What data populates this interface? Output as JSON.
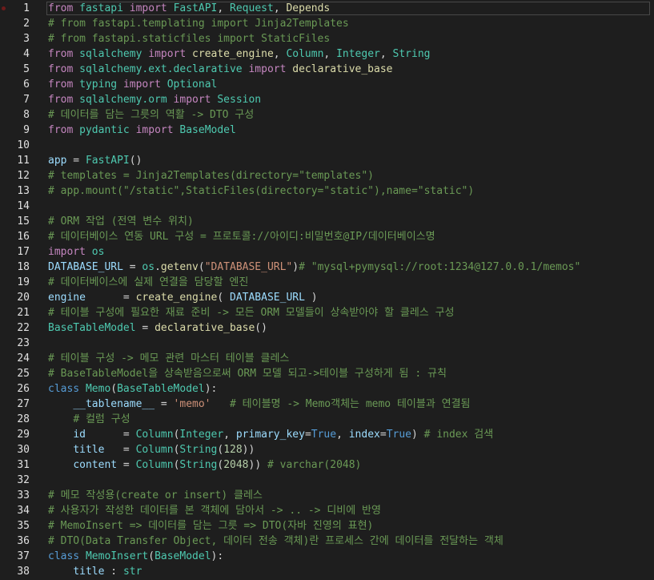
{
  "editor": {
    "breakpoint_line": 1,
    "active_line": 1,
    "lines": [
      {
        "n": "1",
        "tokens": [
          {
            "t": "from",
            "c": "from"
          },
          {
            "t": " "
          },
          {
            "t": "fastapi",
            "c": "module"
          },
          {
            "t": " "
          },
          {
            "t": "import",
            "c": "import"
          },
          {
            "t": " "
          },
          {
            "t": "FastAPI",
            "c": "class"
          },
          {
            "t": ", "
          },
          {
            "t": "Request",
            "c": "class"
          },
          {
            "t": ", "
          },
          {
            "t": "Depends",
            "c": "func"
          }
        ]
      },
      {
        "n": "2",
        "tokens": [
          {
            "t": "# from fastapi.templating import Jinja2Templates",
            "c": "comment"
          }
        ]
      },
      {
        "n": "3",
        "tokens": [
          {
            "t": "# from fastapi.staticfiles import StaticFiles",
            "c": "comment"
          }
        ]
      },
      {
        "n": "4",
        "tokens": [
          {
            "t": "from",
            "c": "from"
          },
          {
            "t": " "
          },
          {
            "t": "sqlalchemy",
            "c": "module"
          },
          {
            "t": " "
          },
          {
            "t": "import",
            "c": "import"
          },
          {
            "t": " "
          },
          {
            "t": "create_engine",
            "c": "func"
          },
          {
            "t": ", "
          },
          {
            "t": "Column",
            "c": "class"
          },
          {
            "t": ", "
          },
          {
            "t": "Integer",
            "c": "class"
          },
          {
            "t": ", "
          },
          {
            "t": "String",
            "c": "class"
          }
        ]
      },
      {
        "n": "5",
        "tokens": [
          {
            "t": "from",
            "c": "from"
          },
          {
            "t": " "
          },
          {
            "t": "sqlalchemy.ext.declarative",
            "c": "module"
          },
          {
            "t": " "
          },
          {
            "t": "import",
            "c": "import"
          },
          {
            "t": " "
          },
          {
            "t": "declarative_base",
            "c": "func"
          }
        ]
      },
      {
        "n": "6",
        "tokens": [
          {
            "t": "from",
            "c": "from"
          },
          {
            "t": " "
          },
          {
            "t": "typing",
            "c": "module"
          },
          {
            "t": " "
          },
          {
            "t": "import",
            "c": "import"
          },
          {
            "t": " "
          },
          {
            "t": "Optional",
            "c": "class"
          }
        ]
      },
      {
        "n": "7",
        "tokens": [
          {
            "t": "from",
            "c": "from"
          },
          {
            "t": " "
          },
          {
            "t": "sqlalchemy.orm",
            "c": "module"
          },
          {
            "t": " "
          },
          {
            "t": "import",
            "c": "import"
          },
          {
            "t": " "
          },
          {
            "t": "Session",
            "c": "class"
          }
        ]
      },
      {
        "n": "8",
        "tokens": [
          {
            "t": "# 데이터를 담는 그릇의 역활 -> DTO 구성",
            "c": "comment"
          }
        ]
      },
      {
        "n": "9",
        "tokens": [
          {
            "t": "from",
            "c": "from"
          },
          {
            "t": " "
          },
          {
            "t": "pydantic",
            "c": "module"
          },
          {
            "t": " "
          },
          {
            "t": "import",
            "c": "import"
          },
          {
            "t": " "
          },
          {
            "t": "BaseModel",
            "c": "class"
          }
        ]
      },
      {
        "n": "10",
        "tokens": []
      },
      {
        "n": "11",
        "tokens": [
          {
            "t": "app",
            "c": "var"
          },
          {
            "t": " = "
          },
          {
            "t": "FastAPI",
            "c": "class"
          },
          {
            "t": "()"
          }
        ]
      },
      {
        "n": "12",
        "tokens": [
          {
            "t": "# templates = Jinja2Templates(directory=\"templates\")",
            "c": "comment"
          }
        ]
      },
      {
        "n": "13",
        "tokens": [
          {
            "t": "# app.mount(\"/static\",StaticFiles(directory=\"static\"),name=\"static\")",
            "c": "comment"
          }
        ]
      },
      {
        "n": "14",
        "tokens": []
      },
      {
        "n": "15",
        "tokens": [
          {
            "t": "# ORM 작업 (전역 변수 위치)",
            "c": "comment"
          }
        ]
      },
      {
        "n": "16",
        "tokens": [
          {
            "t": "# 데이터베이스 연동 URL 구성 = 프로토콜://아이디:비밀번호@IP/데이터베이스명",
            "c": "comment"
          }
        ]
      },
      {
        "n": "17",
        "tokens": [
          {
            "t": "import",
            "c": "import"
          },
          {
            "t": " "
          },
          {
            "t": "os",
            "c": "module"
          }
        ]
      },
      {
        "n": "18",
        "tokens": [
          {
            "t": "DATABASE_URL",
            "c": "var"
          },
          {
            "t": " = "
          },
          {
            "t": "os",
            "c": "module"
          },
          {
            "t": "."
          },
          {
            "t": "getenv",
            "c": "func"
          },
          {
            "t": "("
          },
          {
            "t": "\"DATABASE_URL\"",
            "c": "str"
          },
          {
            "t": ")"
          },
          {
            "t": "# \"mysql+pymysql://root:1234@127.0.0.1/memos\"",
            "c": "comment"
          }
        ]
      },
      {
        "n": "19",
        "tokens": [
          {
            "t": "# 데이터베이스에 실제 연결을 담당할 엔진",
            "c": "comment"
          }
        ]
      },
      {
        "n": "20",
        "tokens": [
          {
            "t": "engine",
            "c": "var"
          },
          {
            "t": "      = "
          },
          {
            "t": "create_engine",
            "c": "func"
          },
          {
            "t": "( "
          },
          {
            "t": "DATABASE_URL",
            "c": "var"
          },
          {
            "t": " )"
          }
        ]
      },
      {
        "n": "21",
        "tokens": [
          {
            "t": "# 테이블 구성에 필요한 재료 준비 -> 모든 ORM 모델들이 상속받아야 할 클레스 구성",
            "c": "comment"
          }
        ]
      },
      {
        "n": "22",
        "tokens": [
          {
            "t": "BaseTableModel",
            "c": "class"
          },
          {
            "t": " = "
          },
          {
            "t": "declarative_base",
            "c": "func"
          },
          {
            "t": "()"
          }
        ]
      },
      {
        "n": "23",
        "tokens": []
      },
      {
        "n": "24",
        "tokens": [
          {
            "t": "# 테이블 구성 -> 메모 관련 마스터 테이블 클레스",
            "c": "comment"
          }
        ]
      },
      {
        "n": "25",
        "tokens": [
          {
            "t": "# BaseTableModel을 상속받음으로써 ORM 모델 되고->테이블 구성하게 됨 : 규칙",
            "c": "comment"
          }
        ]
      },
      {
        "n": "26",
        "tokens": [
          {
            "t": "class",
            "c": "kw"
          },
          {
            "t": " "
          },
          {
            "t": "Memo",
            "c": "class"
          },
          {
            "t": "("
          },
          {
            "t": "BaseTableModel",
            "c": "class"
          },
          {
            "t": "):"
          }
        ]
      },
      {
        "n": "27",
        "tokens": [
          {
            "t": "    "
          },
          {
            "t": "__tablename__",
            "c": "var"
          },
          {
            "t": " = "
          },
          {
            "t": "'memo'",
            "c": "str"
          },
          {
            "t": "   "
          },
          {
            "t": "# 테이블명 -> Memo객체는 memo 테이블과 연결됨",
            "c": "comment"
          }
        ]
      },
      {
        "n": "28",
        "tokens": [
          {
            "t": "    "
          },
          {
            "t": "# 컬럼 구성",
            "c": "comment"
          }
        ]
      },
      {
        "n": "29",
        "tokens": [
          {
            "t": "    "
          },
          {
            "t": "id",
            "c": "var"
          },
          {
            "t": "      = "
          },
          {
            "t": "Column",
            "c": "class"
          },
          {
            "t": "("
          },
          {
            "t": "Integer",
            "c": "class"
          },
          {
            "t": ", "
          },
          {
            "t": "primary_key",
            "c": "var"
          },
          {
            "t": "="
          },
          {
            "t": "True",
            "c": "bool"
          },
          {
            "t": ", "
          },
          {
            "t": "index",
            "c": "var"
          },
          {
            "t": "="
          },
          {
            "t": "True",
            "c": "bool"
          },
          {
            "t": ") "
          },
          {
            "t": "# index 검색",
            "c": "comment"
          }
        ]
      },
      {
        "n": "30",
        "tokens": [
          {
            "t": "    "
          },
          {
            "t": "title",
            "c": "var"
          },
          {
            "t": "   = "
          },
          {
            "t": "Column",
            "c": "class"
          },
          {
            "t": "("
          },
          {
            "t": "String",
            "c": "class"
          },
          {
            "t": "("
          },
          {
            "t": "128",
            "c": "num"
          },
          {
            "t": "))"
          }
        ]
      },
      {
        "n": "31",
        "tokens": [
          {
            "t": "    "
          },
          {
            "t": "content",
            "c": "var"
          },
          {
            "t": " = "
          },
          {
            "t": "Column",
            "c": "class"
          },
          {
            "t": "("
          },
          {
            "t": "String",
            "c": "class"
          },
          {
            "t": "("
          },
          {
            "t": "2048",
            "c": "num"
          },
          {
            "t": ")) "
          },
          {
            "t": "# varchar(2048)",
            "c": "comment"
          }
        ]
      },
      {
        "n": "32",
        "tokens": []
      },
      {
        "n": "33",
        "tokens": [
          {
            "t": "# 메모 작성용(create or insert) 클레스",
            "c": "comment"
          }
        ]
      },
      {
        "n": "34",
        "tokens": [
          {
            "t": "# 사용자가 작성한 데이터를 본 객체에 담아서 -> .. -> 디비에 반영",
            "c": "comment"
          }
        ]
      },
      {
        "n": "35",
        "tokens": [
          {
            "t": "# MemoInsert => 데이터를 담는 그릇 => DTO(자바 진영의 표현)",
            "c": "comment"
          }
        ]
      },
      {
        "n": "36",
        "tokens": [
          {
            "t": "# DTO(Data Transfer Object, 데이터 전송 객체)란 프로세스 간에 데이터를 전달하는 객체",
            "c": "comment"
          }
        ]
      },
      {
        "n": "37",
        "tokens": [
          {
            "t": "class",
            "c": "kw"
          },
          {
            "t": " "
          },
          {
            "t": "MemoInsert",
            "c": "class"
          },
          {
            "t": "("
          },
          {
            "t": "BaseModel",
            "c": "class"
          },
          {
            "t": "):"
          }
        ]
      },
      {
        "n": "38",
        "tokens": [
          {
            "t": "    "
          },
          {
            "t": "title",
            "c": "var"
          },
          {
            "t": " : "
          },
          {
            "t": "str",
            "c": "class"
          }
        ]
      }
    ]
  }
}
